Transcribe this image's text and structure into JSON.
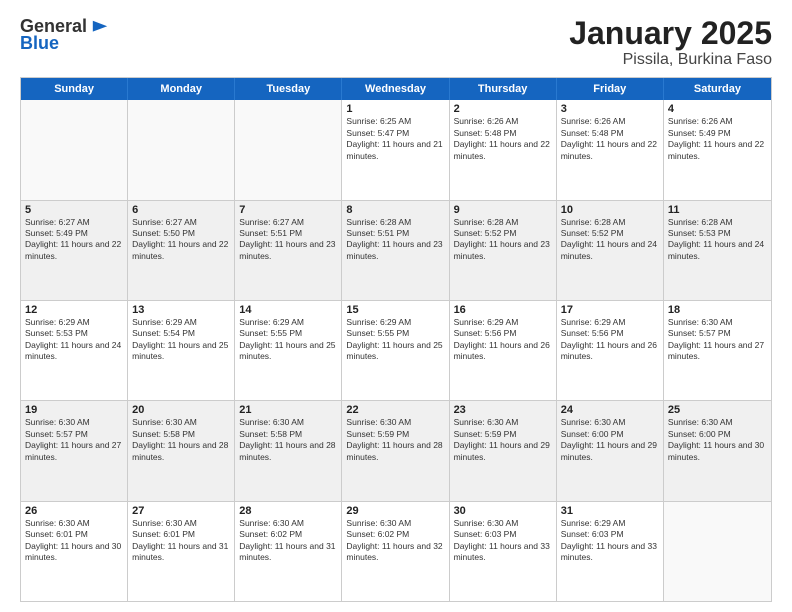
{
  "logo": {
    "general": "General",
    "blue": "Blue"
  },
  "title": "January 2025",
  "subtitle": "Pissila, Burkina Faso",
  "header": {
    "days": [
      "Sunday",
      "Monday",
      "Tuesday",
      "Wednesday",
      "Thursday",
      "Friday",
      "Saturday"
    ]
  },
  "rows": [
    {
      "shaded": false,
      "cells": [
        {
          "empty": true
        },
        {
          "empty": true
        },
        {
          "empty": true
        },
        {
          "day": "1",
          "sunrise": "Sunrise: 6:25 AM",
          "sunset": "Sunset: 5:47 PM",
          "daylight": "Daylight: 11 hours and 21 minutes."
        },
        {
          "day": "2",
          "sunrise": "Sunrise: 6:26 AM",
          "sunset": "Sunset: 5:48 PM",
          "daylight": "Daylight: 11 hours and 22 minutes."
        },
        {
          "day": "3",
          "sunrise": "Sunrise: 6:26 AM",
          "sunset": "Sunset: 5:48 PM",
          "daylight": "Daylight: 11 hours and 22 minutes."
        },
        {
          "day": "4",
          "sunrise": "Sunrise: 6:26 AM",
          "sunset": "Sunset: 5:49 PM",
          "daylight": "Daylight: 11 hours and 22 minutes."
        }
      ]
    },
    {
      "shaded": true,
      "cells": [
        {
          "day": "5",
          "sunrise": "Sunrise: 6:27 AM",
          "sunset": "Sunset: 5:49 PM",
          "daylight": "Daylight: 11 hours and 22 minutes."
        },
        {
          "day": "6",
          "sunrise": "Sunrise: 6:27 AM",
          "sunset": "Sunset: 5:50 PM",
          "daylight": "Daylight: 11 hours and 22 minutes."
        },
        {
          "day": "7",
          "sunrise": "Sunrise: 6:27 AM",
          "sunset": "Sunset: 5:51 PM",
          "daylight": "Daylight: 11 hours and 23 minutes."
        },
        {
          "day": "8",
          "sunrise": "Sunrise: 6:28 AM",
          "sunset": "Sunset: 5:51 PM",
          "daylight": "Daylight: 11 hours and 23 minutes."
        },
        {
          "day": "9",
          "sunrise": "Sunrise: 6:28 AM",
          "sunset": "Sunset: 5:52 PM",
          "daylight": "Daylight: 11 hours and 23 minutes."
        },
        {
          "day": "10",
          "sunrise": "Sunrise: 6:28 AM",
          "sunset": "Sunset: 5:52 PM",
          "daylight": "Daylight: 11 hours and 24 minutes."
        },
        {
          "day": "11",
          "sunrise": "Sunrise: 6:28 AM",
          "sunset": "Sunset: 5:53 PM",
          "daylight": "Daylight: 11 hours and 24 minutes."
        }
      ]
    },
    {
      "shaded": false,
      "cells": [
        {
          "day": "12",
          "sunrise": "Sunrise: 6:29 AM",
          "sunset": "Sunset: 5:53 PM",
          "daylight": "Daylight: 11 hours and 24 minutes."
        },
        {
          "day": "13",
          "sunrise": "Sunrise: 6:29 AM",
          "sunset": "Sunset: 5:54 PM",
          "daylight": "Daylight: 11 hours and 25 minutes."
        },
        {
          "day": "14",
          "sunrise": "Sunrise: 6:29 AM",
          "sunset": "Sunset: 5:55 PM",
          "daylight": "Daylight: 11 hours and 25 minutes."
        },
        {
          "day": "15",
          "sunrise": "Sunrise: 6:29 AM",
          "sunset": "Sunset: 5:55 PM",
          "daylight": "Daylight: 11 hours and 25 minutes."
        },
        {
          "day": "16",
          "sunrise": "Sunrise: 6:29 AM",
          "sunset": "Sunset: 5:56 PM",
          "daylight": "Daylight: 11 hours and 26 minutes."
        },
        {
          "day": "17",
          "sunrise": "Sunrise: 6:29 AM",
          "sunset": "Sunset: 5:56 PM",
          "daylight": "Daylight: 11 hours and 26 minutes."
        },
        {
          "day": "18",
          "sunrise": "Sunrise: 6:30 AM",
          "sunset": "Sunset: 5:57 PM",
          "daylight": "Daylight: 11 hours and 27 minutes."
        }
      ]
    },
    {
      "shaded": true,
      "cells": [
        {
          "day": "19",
          "sunrise": "Sunrise: 6:30 AM",
          "sunset": "Sunset: 5:57 PM",
          "daylight": "Daylight: 11 hours and 27 minutes."
        },
        {
          "day": "20",
          "sunrise": "Sunrise: 6:30 AM",
          "sunset": "Sunset: 5:58 PM",
          "daylight": "Daylight: 11 hours and 28 minutes."
        },
        {
          "day": "21",
          "sunrise": "Sunrise: 6:30 AM",
          "sunset": "Sunset: 5:58 PM",
          "daylight": "Daylight: 11 hours and 28 minutes."
        },
        {
          "day": "22",
          "sunrise": "Sunrise: 6:30 AM",
          "sunset": "Sunset: 5:59 PM",
          "daylight": "Daylight: 11 hours and 28 minutes."
        },
        {
          "day": "23",
          "sunrise": "Sunrise: 6:30 AM",
          "sunset": "Sunset: 5:59 PM",
          "daylight": "Daylight: 11 hours and 29 minutes."
        },
        {
          "day": "24",
          "sunrise": "Sunrise: 6:30 AM",
          "sunset": "Sunset: 6:00 PM",
          "daylight": "Daylight: 11 hours and 29 minutes."
        },
        {
          "day": "25",
          "sunrise": "Sunrise: 6:30 AM",
          "sunset": "Sunset: 6:00 PM",
          "daylight": "Daylight: 11 hours and 30 minutes."
        }
      ]
    },
    {
      "shaded": false,
      "cells": [
        {
          "day": "26",
          "sunrise": "Sunrise: 6:30 AM",
          "sunset": "Sunset: 6:01 PM",
          "daylight": "Daylight: 11 hours and 30 minutes."
        },
        {
          "day": "27",
          "sunrise": "Sunrise: 6:30 AM",
          "sunset": "Sunset: 6:01 PM",
          "daylight": "Daylight: 11 hours and 31 minutes."
        },
        {
          "day": "28",
          "sunrise": "Sunrise: 6:30 AM",
          "sunset": "Sunset: 6:02 PM",
          "daylight": "Daylight: 11 hours and 31 minutes."
        },
        {
          "day": "29",
          "sunrise": "Sunrise: 6:30 AM",
          "sunset": "Sunset: 6:02 PM",
          "daylight": "Daylight: 11 hours and 32 minutes."
        },
        {
          "day": "30",
          "sunrise": "Sunrise: 6:30 AM",
          "sunset": "Sunset: 6:03 PM",
          "daylight": "Daylight: 11 hours and 33 minutes."
        },
        {
          "day": "31",
          "sunrise": "Sunrise: 6:29 AM",
          "sunset": "Sunset: 6:03 PM",
          "daylight": "Daylight: 11 hours and 33 minutes."
        },
        {
          "empty": true
        }
      ]
    }
  ]
}
